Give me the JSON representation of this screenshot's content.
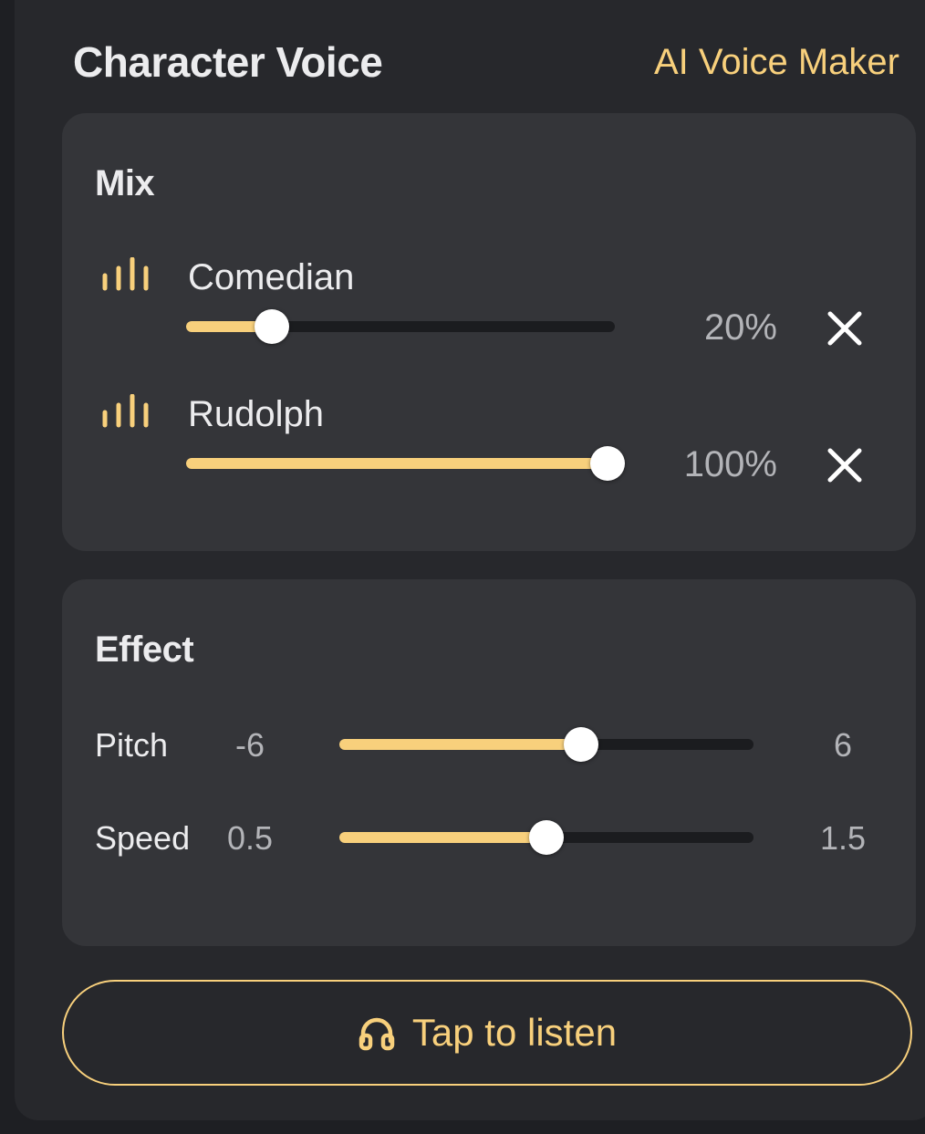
{
  "header": {
    "title": "Character Voice",
    "link_label": "AI Voice Maker"
  },
  "mix": {
    "title": "Mix",
    "voices": [
      {
        "name": "Comedian",
        "percent_label": "20%",
        "level": 0.2,
        "icon": "sound-wave-icon",
        "remove_icon": "close-icon"
      },
      {
        "name": "Rudolph",
        "percent_label": "100%",
        "level": 1.0,
        "icon": "sound-wave-icon",
        "remove_icon": "close-icon"
      }
    ]
  },
  "effect": {
    "title": "Effect",
    "pitch": {
      "label": "Pitch",
      "min_label": "-6",
      "max_label": "6",
      "min": -6,
      "max": 6,
      "value": 1
    },
    "speed": {
      "label": "Speed",
      "min_label": "0.5",
      "max_label": "1.5",
      "min": 0.5,
      "max": 1.5,
      "value": 1.0
    }
  },
  "listen_button": {
    "label": "Tap to listen",
    "icon": "headphones-icon"
  },
  "colors": {
    "accent": "#f8d07c",
    "panel": "#27282c",
    "card": "#343539",
    "track": "#1b1c1f"
  }
}
